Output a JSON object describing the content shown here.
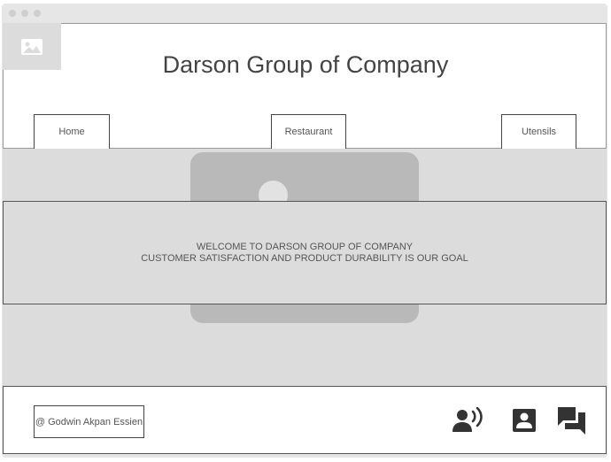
{
  "header": {
    "title": "Darson Group of Company",
    "logo_icon": "image-placeholder-icon"
  },
  "nav": {
    "items": [
      {
        "label": "Home"
      },
      {
        "label": "Restaurant"
      },
      {
        "label": "Utensils"
      }
    ]
  },
  "hero": {
    "image_icon": "image-placeholder-icon",
    "welcome": "WELCOME TO DARSON GROUP OF COMPANY",
    "tagline": "CUSTOMER SATISFACTION AND PRODUCT DURABILITY IS OUR GOAL"
  },
  "footer": {
    "credit": "@ Godwin Akpan Essien",
    "icons": [
      "record-voice-icon",
      "contact-card-icon",
      "chat-bubbles-icon"
    ]
  },
  "colors": {
    "frame": "#e6e6e6",
    "placeholder": "#dcdcdc",
    "image_block": "#b9b9b9",
    "text": "#444444",
    "icon": "#333333"
  }
}
